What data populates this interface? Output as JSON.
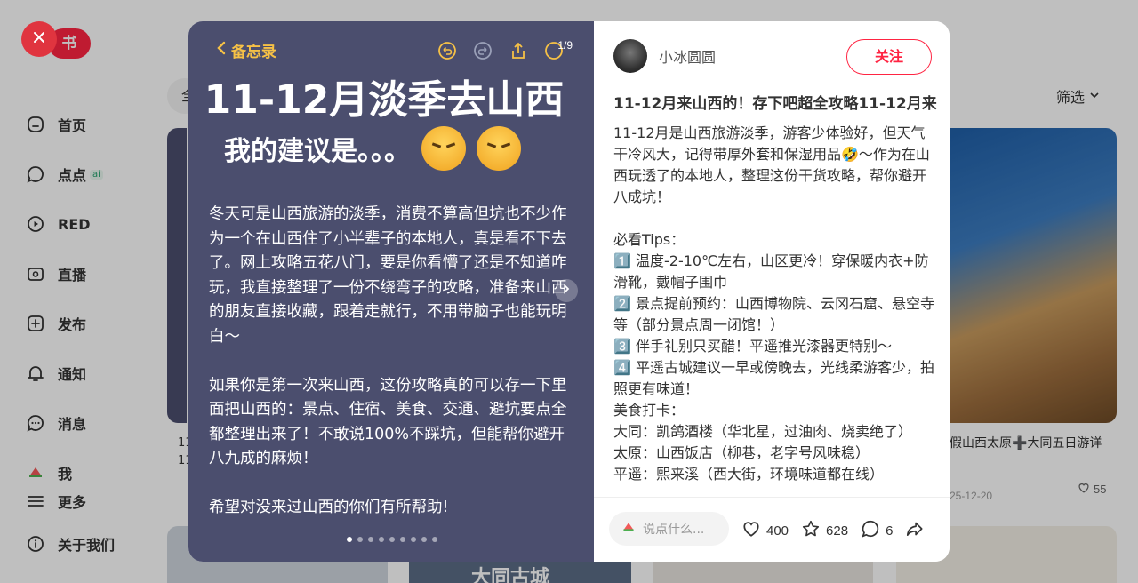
{
  "sidebar": {
    "logo": "书",
    "items": [
      {
        "label": "首页"
      },
      {
        "label": "点点",
        "badge": "ai"
      },
      {
        "label": "RED"
      },
      {
        "label": "直播"
      },
      {
        "label": "发布"
      },
      {
        "label": "通知"
      },
      {
        "label": "消息"
      },
      {
        "label": "我"
      },
      {
        "label": "更多"
      },
      {
        "label": "关于我们"
      }
    ]
  },
  "background": {
    "filter_chip": "全",
    "filter_label": "筛选",
    "left_card_lines": [
      "11",
      "11"
    ],
    "right_card_title": "假山西太原➕大同五日游详",
    "right_card_date": "25-12-20",
    "right_card_likes": "55",
    "bottom_card2_text": "大同古城"
  },
  "media": {
    "back_label": "备忘录",
    "page_counter": "1/9",
    "big_title": "11-12月淡季去山西",
    "sub_title": "我的建议是。。。",
    "body": "冬天可是山西旅游的淡季，消费不算高但坑也不少作为一个在山西住了小半辈子的本地人，真是看不下去了。网上攻略五花八门，要是你看懵了还是不知道咋玩，我直接整理了一份不绕弯子的攻略，准备来山西的朋友直接收藏，跟着走就行，不用带脑子也能玩明白～\n\n如果你是第一次来山西，这份攻略真的可以存一下里面把山西的：景点、住宿、美食、交通、避坑要点全都整理出来了！不敢说100%不踩坑，但能帮你避开八九成的麻烦！\n\n希望对没来过山西的你们有所帮助!",
    "dot_count": 9,
    "active_dot": 0
  },
  "note": {
    "author_name": "小冰圆圆",
    "follow_label": "关注",
    "title": "11-12月来山西的！存下吧超全攻略11-12月来",
    "description": "11-12月是山西旅游淡季，游客少体验好，但天气干冷风大，记得带厚外套和保湿用品🤣～作为在山西玩透了的本地人，整理这份干货攻略，帮你避开八成坑！\n\n必看Tips：\n1️⃣ 温度-2-10℃左右，山区更冷！穿保暖内衣+防滑靴，戴帽子围巾\n2️⃣ 景点提前预约：山西博物院、云冈石窟、悬空寺等（部分景点周一闭馆！）\n3️⃣ 伴手礼别只买醋！平遥推光漆器更特别～\n4️⃣ 平遥古城建议一早或傍晚去，光线柔游客少，拍照更有味道！\n美食打卡：\n大同：凯鸽酒楼（华北星，过油肉、烧卖绝了）\n太原：山西饭店（柳巷，老字号风味稳）\n平遥：熙来溪（西大街，环境味道都在线）",
    "comment_placeholder": "说点什么...",
    "likes": "400",
    "collects": "628",
    "comments": "6"
  },
  "colors": {
    "brand": "#ff2442",
    "media_bg": "#4b4e6e",
    "accent_yellow": "#f6c146"
  }
}
